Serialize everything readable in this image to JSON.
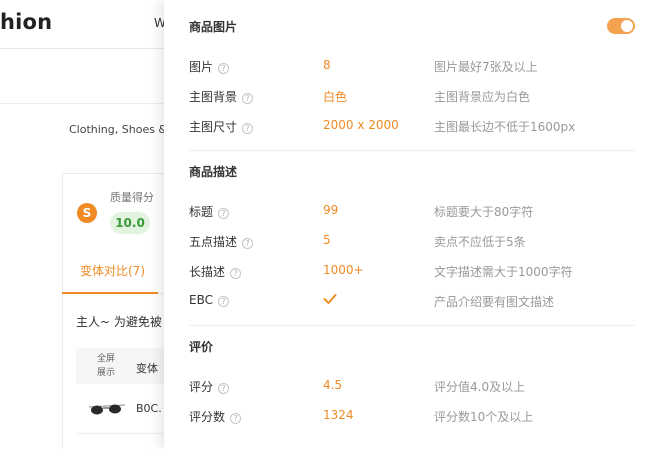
{
  "background": {
    "title_fragment": "hion",
    "header_fragment": "W",
    "category_fragment": "Clothing, Shoes &",
    "score": {
      "icon_letter": "S",
      "label": "质量得分",
      "value": "10.0"
    },
    "active_tab": "变体对比(7)",
    "notice_fragment": "主人~ 为避免被",
    "table": {
      "fullscreen_header": [
        "全屏",
        "展示"
      ],
      "variant_header": "变体",
      "first_row_variant": "B0C."
    }
  },
  "panel": {
    "toggle": {
      "state": "on",
      "color": "#f3a34f"
    },
    "sections": [
      {
        "title": "商品图片",
        "rows": [
          {
            "label": "图片",
            "value": "8",
            "hint": "图片最好7张及以上"
          },
          {
            "label": "主图背景",
            "value": "白色",
            "hint": "主图背景应为白色"
          },
          {
            "label": "主图尺寸",
            "value": "2000 x 2000",
            "hint": "主图最长边不低于1600px"
          }
        ]
      },
      {
        "title": "商品描述",
        "rows": [
          {
            "label": "标题",
            "value": "99",
            "hint": "标题要大于80字符"
          },
          {
            "label": "五点描述",
            "value": "5",
            "hint": "卖点不应低于5条"
          },
          {
            "label": "长描述",
            "value": "1000+",
            "hint": "文字描述需大于1000字符"
          },
          {
            "label": "EBC",
            "value_icon": "check-icon",
            "hint": "产品介绍要有图文描述"
          }
        ]
      },
      {
        "title": "评价",
        "rows": [
          {
            "label": "评分",
            "value": "4.5",
            "hint": "评分值4.0及以上"
          },
          {
            "label": "评分数",
            "value": "1324",
            "hint": "评分数10个及以上"
          }
        ]
      }
    ],
    "help_icon_glyph": "?"
  },
  "colors": {
    "accent": "#f08a24",
    "score_badge_bg": "#e2f4df",
    "score_badge_text": "#3a9a3a",
    "hint_text": "#999999"
  }
}
